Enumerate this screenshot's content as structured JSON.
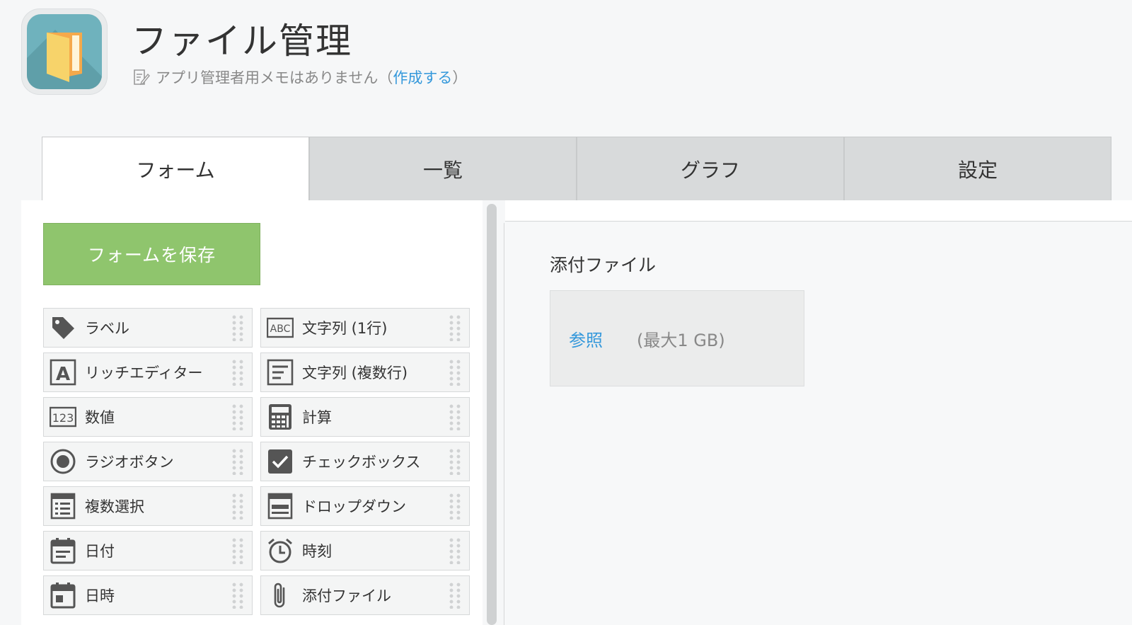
{
  "header": {
    "app_title": "ファイル管理",
    "memo_text": "アプリ管理者用メモはありません（",
    "memo_link": "作成する",
    "memo_close": "）",
    "icon_color": "#6fb2bd"
  },
  "tabs": [
    {
      "label": "フォーム",
      "active": true
    },
    {
      "label": "一覧",
      "active": false
    },
    {
      "label": "グラフ",
      "active": false
    },
    {
      "label": "設定",
      "active": false
    }
  ],
  "palette": {
    "save_label": "フォームを保存",
    "save_color": "#8fc56d",
    "fields": [
      {
        "label": "ラベル",
        "icon": "tag-icon"
      },
      {
        "label": "文字列 (1行)",
        "icon": "abc-icon"
      },
      {
        "label": "リッチエディター",
        "icon": "rich-editor-icon"
      },
      {
        "label": "文字列 (複数行)",
        "icon": "multiline-text-icon"
      },
      {
        "label": "数値",
        "icon": "number-icon"
      },
      {
        "label": "計算",
        "icon": "calculator-icon"
      },
      {
        "label": "ラジオボタン",
        "icon": "radio-icon"
      },
      {
        "label": "チェックボックス",
        "icon": "checkbox-icon"
      },
      {
        "label": "複数選択",
        "icon": "multi-select-icon"
      },
      {
        "label": "ドロップダウン",
        "icon": "dropdown-icon"
      },
      {
        "label": "日付",
        "icon": "calendar-icon"
      },
      {
        "label": "時刻",
        "icon": "alarm-clock-icon"
      },
      {
        "label": "日時",
        "icon": "datetime-icon"
      },
      {
        "label": "添付ファイル",
        "icon": "paperclip-icon"
      }
    ]
  },
  "canvas": {
    "field_label": "添付ファイル",
    "browse_label": "参照",
    "limit_label": "(最大1 GB)"
  },
  "colors": {
    "link": "#3498db",
    "tab_inactive": "#d8dadb"
  }
}
